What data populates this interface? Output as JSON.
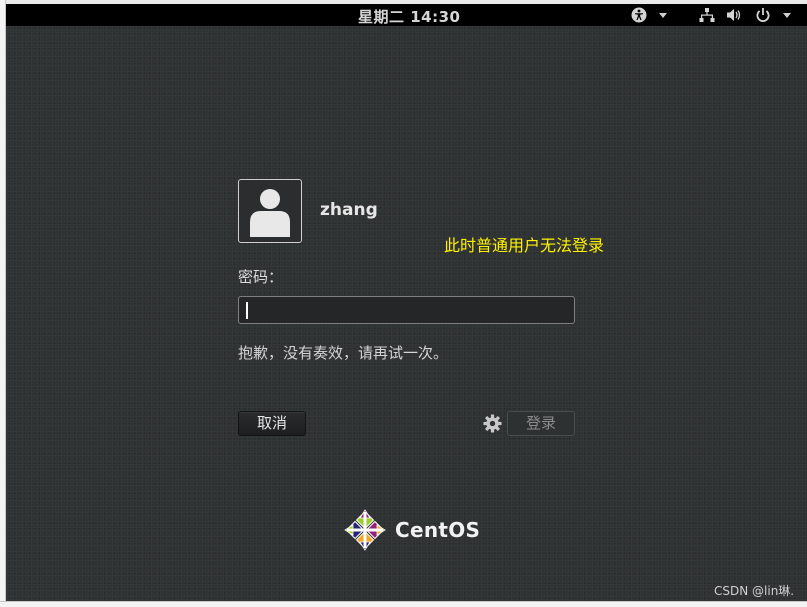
{
  "topbar": {
    "clock": "星期二 14:30",
    "icons": [
      "accessibility-icon",
      "network-icon",
      "volume-icon",
      "power-icon"
    ]
  },
  "login": {
    "username": "zhang",
    "password_label": "密码：",
    "password_value": "",
    "error_message": "抱歉，没有奏效，请再试一次。",
    "cancel_label": "取消",
    "login_label": "登录"
  },
  "annotation": "此时普通用户无法登录",
  "branding": {
    "logo_text": "CentOS"
  },
  "watermark": "CSDN @lin琳."
}
